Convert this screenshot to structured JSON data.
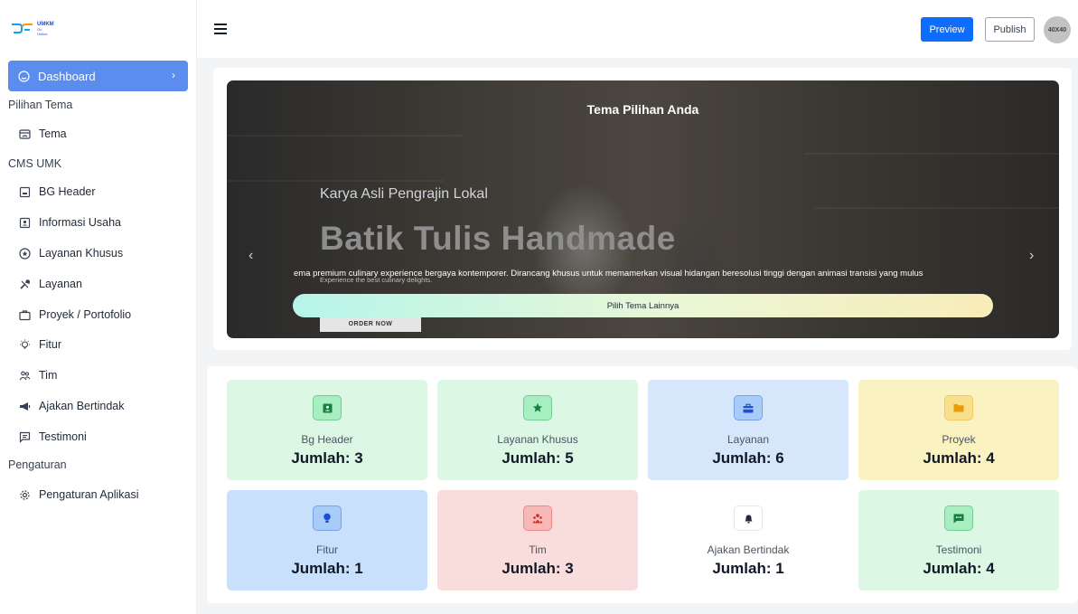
{
  "app": {
    "logo_text": "UMKM",
    "logo_sub_1": "Go",
    "logo_sub_2": "Online"
  },
  "sidebar": {
    "active": {
      "label": "Dashboard",
      "icon": "dashboard-icon"
    },
    "sections": [
      {
        "title": "Pilihan Tema",
        "items": [
          {
            "label": "Tema",
            "icon": "theme-icon"
          }
        ]
      },
      {
        "title": "CMS UMK",
        "items": [
          {
            "label": "BG Header",
            "icon": "image-icon"
          },
          {
            "label": "Informasi Usaha",
            "icon": "contact-card-icon"
          },
          {
            "label": "Layanan Khusus",
            "icon": "star-circle-icon"
          },
          {
            "label": "Layanan",
            "icon": "tools-icon"
          },
          {
            "label": "Proyek / Portofolio",
            "icon": "briefcase-icon"
          },
          {
            "label": "Fitur",
            "icon": "lightbulb-icon"
          },
          {
            "label": "Tim",
            "icon": "people-icon"
          },
          {
            "label": "Ajakan Bertindak",
            "icon": "megaphone-icon"
          },
          {
            "label": "Testimoni",
            "icon": "chat-icon"
          }
        ]
      },
      {
        "title": "Pengaturan",
        "items": [
          {
            "label": "Pengaturan Aplikasi",
            "icon": "gear-icon"
          }
        ]
      }
    ]
  },
  "topbar": {
    "preview_label": "Preview",
    "publish_label": "Publish",
    "avatar_text": "40X40"
  },
  "banner": {
    "title": "Tema Pilihan Anda",
    "kicker": "Karya Asli Pengrajin Lokal",
    "headline": "Batik Tulis Handmade",
    "small": "Experience the best culinary delights.",
    "description": "ema premium culinary experience bergaya kontemporer. Dirancang khusus untuk memamerkan visual hidangan beresolusi tinggi dengan animasi transisi yang mulus",
    "button": "Pilih Tema Lainnya",
    "order_button": "ORDER NOW"
  },
  "stats": [
    {
      "label": "Bg Header",
      "count": "Jumlah: 3",
      "bg": "#dcf7e3",
      "badge_bg": "#a7efc0",
      "icon_color": "#15803d",
      "icon": "contact-card-icon"
    },
    {
      "label": "Layanan Khusus",
      "count": "Jumlah: 5",
      "bg": "#dcf7e3",
      "badge_bg": "#a7efc0",
      "icon_color": "#15803d",
      "icon": "star-icon"
    },
    {
      "label": "Layanan",
      "count": "Jumlah: 6",
      "bg": "#d6e6fb",
      "badge_bg": "#a9cbf7",
      "icon_color": "#1d4ed8",
      "icon": "briefcase-icon"
    },
    {
      "label": "Proyek",
      "count": "Jumlah: 4",
      "bg": "#fbf2c2",
      "badge_bg": "#f8e08a",
      "icon_color": "#ea9a0b",
      "icon": "folder-icon"
    },
    {
      "label": "Fitur",
      "count": "Jumlah: 1",
      "bg": "#c8e0fb",
      "badge_bg": "#a9cbf7",
      "icon_color": "#1d4ed8",
      "icon": "lightbulb-icon"
    },
    {
      "label": "Tim",
      "count": "Jumlah: 3",
      "bg": "#f9dcdc",
      "badge_bg": "#f7b8b8",
      "icon_color": "#dc2626",
      "icon": "people-icon"
    },
    {
      "label": "Ajakan Bertindak",
      "count": "Jumlah: 1",
      "bg": "#ffffff",
      "badge_bg": "#ffffff",
      "icon_color": "#1f2937",
      "icon": "bell-icon"
    },
    {
      "label": "Testimoni",
      "count": "Jumlah: 4",
      "bg": "#dcf7e3",
      "badge_bg": "#a7efc0",
      "icon_color": "#15803d",
      "icon": "chat-icon"
    }
  ]
}
